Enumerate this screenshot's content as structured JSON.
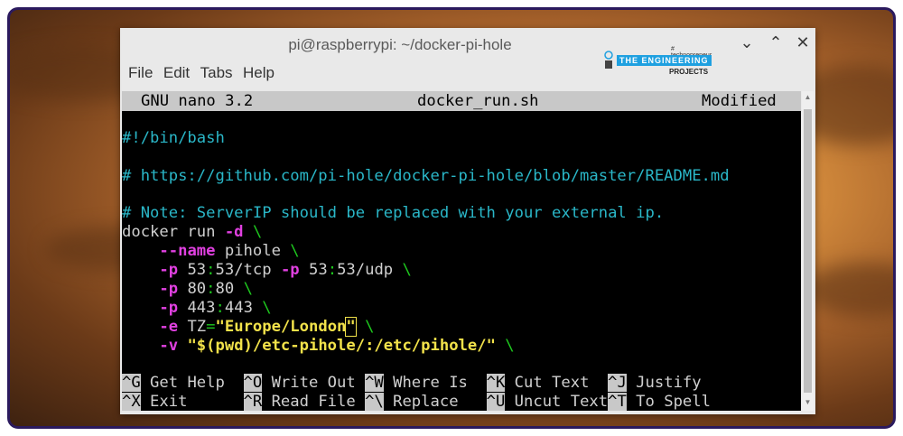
{
  "window": {
    "title": "pi@raspberrypi: ~/docker-pi-hole",
    "controls": [
      "chevron-down-icon",
      "chevron-up-icon",
      "close-icon"
    ]
  },
  "watermark": {
    "small": "# technopreneur",
    "badge": "THE ENGINEERING",
    "projects": "PROJECTS"
  },
  "menu": [
    "File",
    "Edit",
    "Tabs",
    "Help"
  ],
  "nano": {
    "version": "GNU nano 3.2",
    "filename": "docker_run.sh",
    "status": "Modified"
  },
  "code": {
    "shebang": "#!/bin/bash",
    "url_comment": "# https://github.com/pi-hole/docker-pi-hole/blob/master/README.md",
    "note_comment": "# Note: ServerIP should be replaced with your external ip.",
    "l1_cmd": "docker run ",
    "l1_flag": "-d",
    "bs": "\\",
    "l2_flag": "--name",
    "l2_val": " pihole ",
    "l3_f1": "-p",
    "l3_a": " 53",
    "colon": ":",
    "l3_b": "53/tcp ",
    "l3_f2": "-p",
    "l3_c": " 53",
    "l3_d": "53/udp ",
    "l4_f": "-p",
    "l4_a": " 80",
    "l4_b": "80 ",
    "l5_f": "-p",
    "l5_a": " 443",
    "l5_b": "443 ",
    "l6_f": "-e",
    "l6_a": " TZ",
    "eq": "=",
    "l6_str": "\"Europe/London",
    "l6_q": "\"",
    "l7_f": "-v",
    "l7_str": " \"$(pwd)/etc-pihole/:/etc/pihole/\" "
  },
  "shortcuts": [
    {
      "key": "^G",
      "label": " Get Help  "
    },
    {
      "key": "^O",
      "label": " Write Out "
    },
    {
      "key": "^W",
      "label": " Where Is  "
    },
    {
      "key": "^K",
      "label": " Cut Text  "
    },
    {
      "key": "^J",
      "label": " Justify"
    },
    {
      "key": "^X",
      "label": " Exit      "
    },
    {
      "key": "^R",
      "label": " Read File "
    },
    {
      "key": "^\\",
      "label": " Replace   "
    },
    {
      "key": "^U",
      "label": " Uncut Text"
    },
    {
      "key": "^T",
      "label": " To Spell"
    }
  ]
}
